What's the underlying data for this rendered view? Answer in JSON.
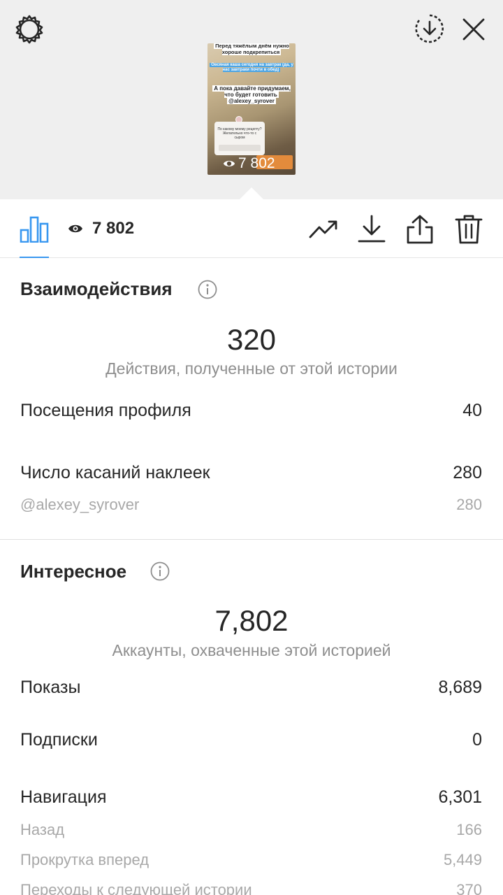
{
  "story_preview": {
    "text_line_1": "Перед тяжёлым днём нужно хороше подкрепиться",
    "text_line_2": "Овсяная каша сегодня на завтрак (да, у нас завтраки почти в обед)",
    "text_line_3": "А пока давайте придумаем, что будет готовить",
    "mention": "@alexey_syrover",
    "question": "По какому моему рецепту? Желательно что-то с сыром",
    "views": "7 802"
  },
  "toolbar": {
    "views_count": "7 802"
  },
  "interactions": {
    "title": "Взаимодействия",
    "total": "320",
    "total_caption": "Действия, полученные от этой истории",
    "rows": [
      {
        "label": "Посещения профиля",
        "value": "40"
      },
      {
        "label": "Число касаний наклеек",
        "value": "280"
      },
      {
        "label": "@alexey_syrover",
        "value": "280"
      }
    ]
  },
  "discovery": {
    "title": "Интересное",
    "total": "7,802",
    "total_caption": "Аккаунты, охваченные этой историей",
    "rows": [
      {
        "label": "Показы",
        "value": "8,689"
      },
      {
        "label": "Подписки",
        "value": "0"
      },
      {
        "label": "Навигация",
        "value": "6,301"
      },
      {
        "label": "Назад",
        "value": "166"
      },
      {
        "label": "Прокрутка вперед",
        "value": "5,449"
      },
      {
        "label": "Переходы к следующей истории",
        "value": "370"
      }
    ]
  },
  "colors": {
    "accent": "#3897f0",
    "header_bg": "#efefef",
    "secondary_text": "#8e8e8e"
  }
}
